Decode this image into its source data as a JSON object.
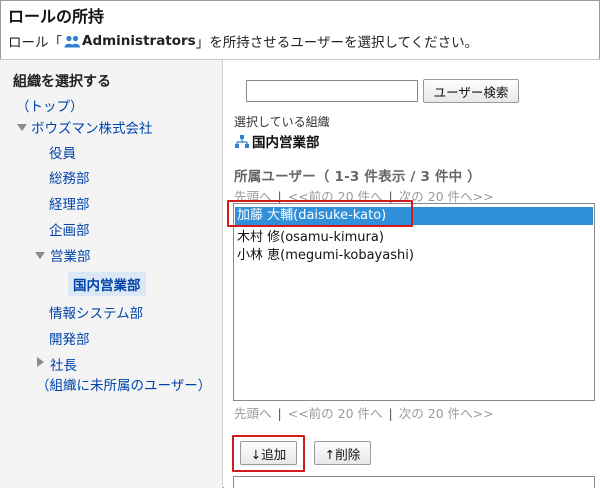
{
  "page": {
    "title": "ロールの所持",
    "description_prefix": "ロール「",
    "role_name": "Administrators",
    "description_suffix": "」を所持させるユーザーを選択してください。"
  },
  "org_tree": {
    "heading": "組織を選択する",
    "items": [
      {
        "label": "（トップ）"
      },
      {
        "label": "ボウズマン株式会社",
        "expanded": true
      },
      {
        "label": "役員"
      },
      {
        "label": "総務部"
      },
      {
        "label": "経理部"
      },
      {
        "label": "企画部"
      },
      {
        "label": "営業部",
        "expanded": true
      },
      {
        "label": "国内営業部",
        "selected": true
      },
      {
        "label": "情報システム部"
      },
      {
        "label": "開発部"
      },
      {
        "label": "社長",
        "expanded": false
      },
      {
        "label": "（組織に未所属のユーザー）"
      }
    ]
  },
  "search": {
    "value": "",
    "button_label": "ユーザー検索"
  },
  "selected_org": {
    "label": "選択している組織",
    "name": "国内営業部"
  },
  "members": {
    "header": "所属ユーザー（ 1-3 件表示 / 3 件中 ）",
    "pager": {
      "first": "先頭へ",
      "prev": "<<前の 20 件へ",
      "next": "次の 20 件へ>>"
    },
    "users": [
      {
        "label": "加藤 大輔(daisuke-kato)",
        "selected": true
      },
      {
        "label": "木村 修(osamu-kimura)",
        "selected": false
      },
      {
        "label": "小林 恵(megumi-kobayashi)",
        "selected": false
      }
    ]
  },
  "actions": {
    "add_label": "↓追加",
    "remove_label": "↑削除"
  },
  "colors": {
    "link": "#0044aa",
    "selection": "#2f8fd8",
    "highlight_box": "#d21c1c",
    "tree_selected_bg": "#dde8f6"
  }
}
